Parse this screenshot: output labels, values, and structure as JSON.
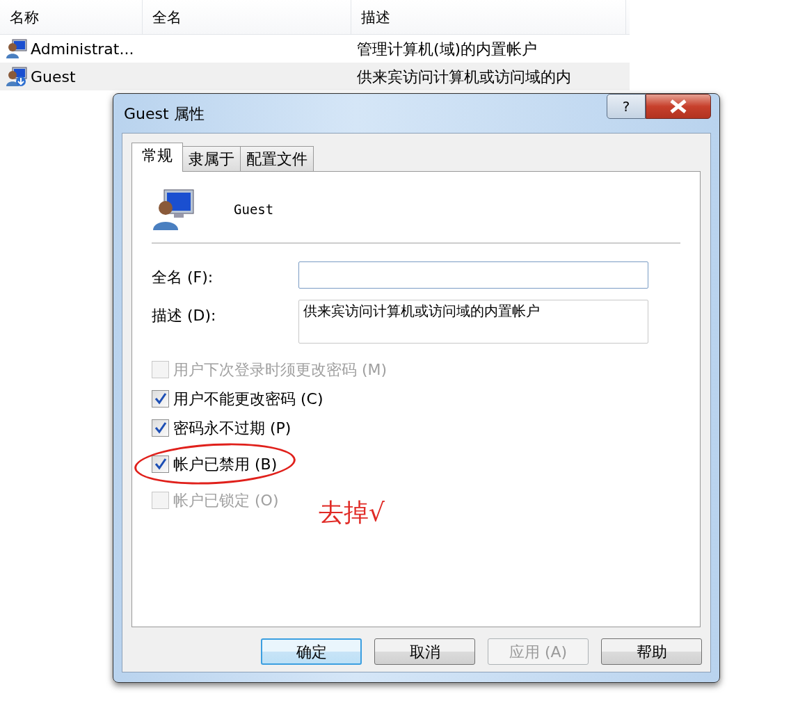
{
  "list": {
    "columns": [
      "名称",
      "全名",
      "描述"
    ],
    "rows": [
      {
        "name": "Administrat...",
        "description": "管理计算机(域)的内置帐户",
        "selected": false
      },
      {
        "name": "Guest",
        "description": "供来宾访问计算机或访问域的内",
        "selected": true
      }
    ]
  },
  "dialog": {
    "title": "Guest 属性",
    "title_buttons": [
      "?"
    ],
    "tabs": [
      {
        "label": "常规",
        "selected": true
      },
      {
        "label": "隶属于",
        "selected": false
      },
      {
        "label": "配置文件",
        "selected": false
      }
    ],
    "user_name": "Guest",
    "fields": [
      {
        "label": "全名 (F):",
        "multiline": false
      },
      {
        "label": "描述 (D):",
        "value": "供来宾访问计算机或访问域的内置帐户",
        "multiline": true
      }
    ],
    "options": [
      {
        "label": "用户下次登录时须更改密码 (M)",
        "checked": false,
        "disabled": true,
        "circled": false
      },
      {
        "label": "用户不能更改密码 (C)",
        "checked": true,
        "disabled": false,
        "circled": false
      },
      {
        "label": "密码永不过期 (P)",
        "checked": true,
        "disabled": false,
        "circled": false
      },
      {
        "label": "帐户已禁用 (B)",
        "checked": true,
        "disabled": false,
        "circled": true
      },
      {
        "label": "帐户已锁定 (O)",
        "checked": false,
        "disabled": true,
        "circled": false
      }
    ],
    "annotation": "去掉√",
    "buttons": [
      {
        "label": "确定",
        "default": true,
        "disabled": false
      },
      {
        "label": "取消",
        "default": false,
        "disabled": false
      },
      {
        "label": "应用 (A)",
        "default": false,
        "disabled": true
      },
      {
        "label": "帮助",
        "default": false,
        "disabled": false
      }
    ]
  }
}
